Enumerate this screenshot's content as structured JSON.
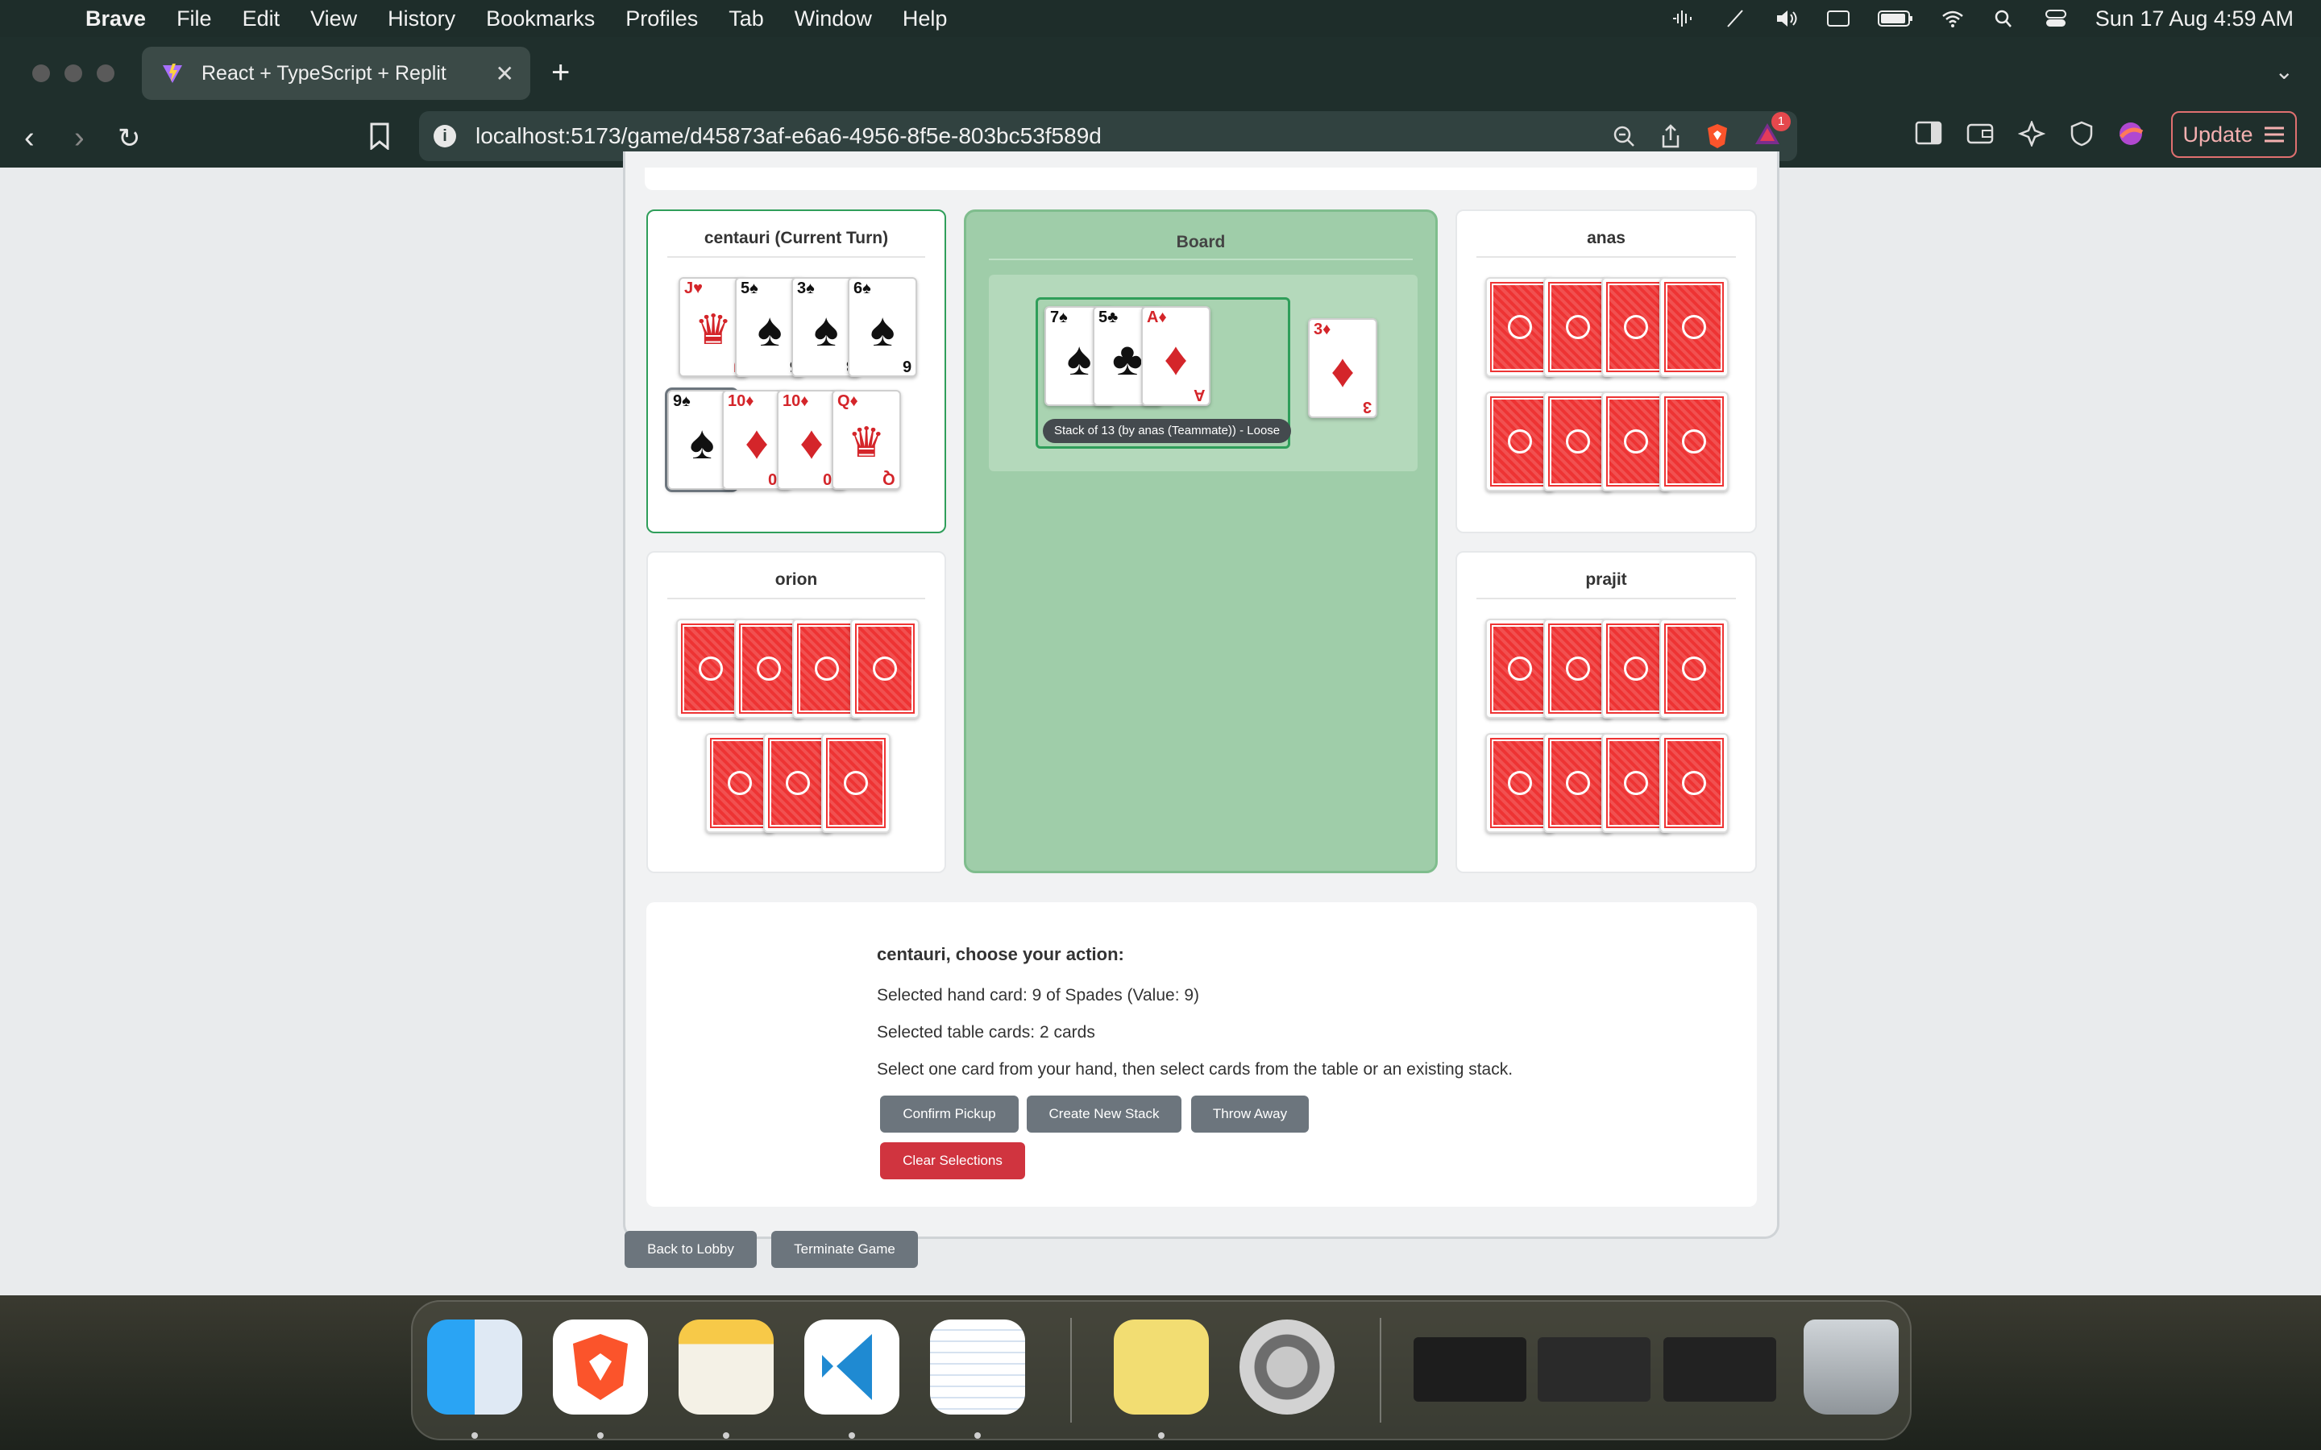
{
  "menubar": {
    "app": "Brave",
    "items": [
      "File",
      "Edit",
      "View",
      "History",
      "Bookmarks",
      "Profiles",
      "Tab",
      "Window",
      "Help"
    ],
    "datetime": "Sun 17 Aug  4:59 AM"
  },
  "browser": {
    "tab_title": "React + TypeScript + Replit",
    "url": "localhost:5173/game/d45873af-e6a6-4956-8f5e-803bc53f589d",
    "update_label": "Update",
    "notification_count": "1"
  },
  "players": {
    "current": {
      "name": "centauri (Current Turn)"
    },
    "top_right": {
      "name": "anas"
    },
    "bottom_left": {
      "name": "orion"
    },
    "bottom_right": {
      "name": "prajit"
    }
  },
  "hand": {
    "row1": [
      {
        "rank": "J",
        "suit": "♥",
        "color": "red",
        "face": true
      },
      {
        "rank": "5",
        "suit": "♠",
        "color": "black"
      },
      {
        "rank": "3",
        "suit": "♠",
        "color": "black"
      },
      {
        "rank": "6",
        "suit": "♠",
        "color": "black"
      }
    ],
    "row2": [
      {
        "rank": "9",
        "suit": "♠",
        "color": "black",
        "selected": true
      },
      {
        "rank": "10",
        "suit": "♦",
        "color": "red"
      },
      {
        "rank": "10",
        "suit": "♦",
        "color": "red"
      },
      {
        "rank": "Q",
        "suit": "♦",
        "color": "red",
        "face": true
      }
    ]
  },
  "board": {
    "title": "Board",
    "stack_cards": [
      {
        "rank": "7",
        "suit": "♠",
        "color": "black"
      },
      {
        "rank": "5",
        "suit": "♣",
        "color": "black"
      },
      {
        "rank": "A",
        "suit": "♦",
        "color": "red"
      }
    ],
    "stack_label": "Stack of 13 (by anas (Teammate)) - Loose",
    "loose_card": {
      "rank": "3",
      "suit": "♦",
      "color": "red"
    }
  },
  "action": {
    "heading": "centauri, choose your action:",
    "selected_hand": "Selected hand card: 9 of Spades (Value: 9)",
    "selected_table": "Selected table cards: 2 cards",
    "instructions": "Select one card from your hand, then select cards from the table or an existing stack.",
    "buttons": {
      "confirm": "Confirm Pickup",
      "create": "Create New Stack",
      "throw": "Throw Away",
      "clear": "Clear Selections"
    }
  },
  "footer_buttons": {
    "back": "Back to Lobby",
    "terminate": "Terminate Game"
  },
  "colors": {
    "accent_green": "#2f9e5a",
    "board_green": "#9fcda9",
    "danger_red": "#d0343f",
    "button_grey": "#6c757d"
  }
}
